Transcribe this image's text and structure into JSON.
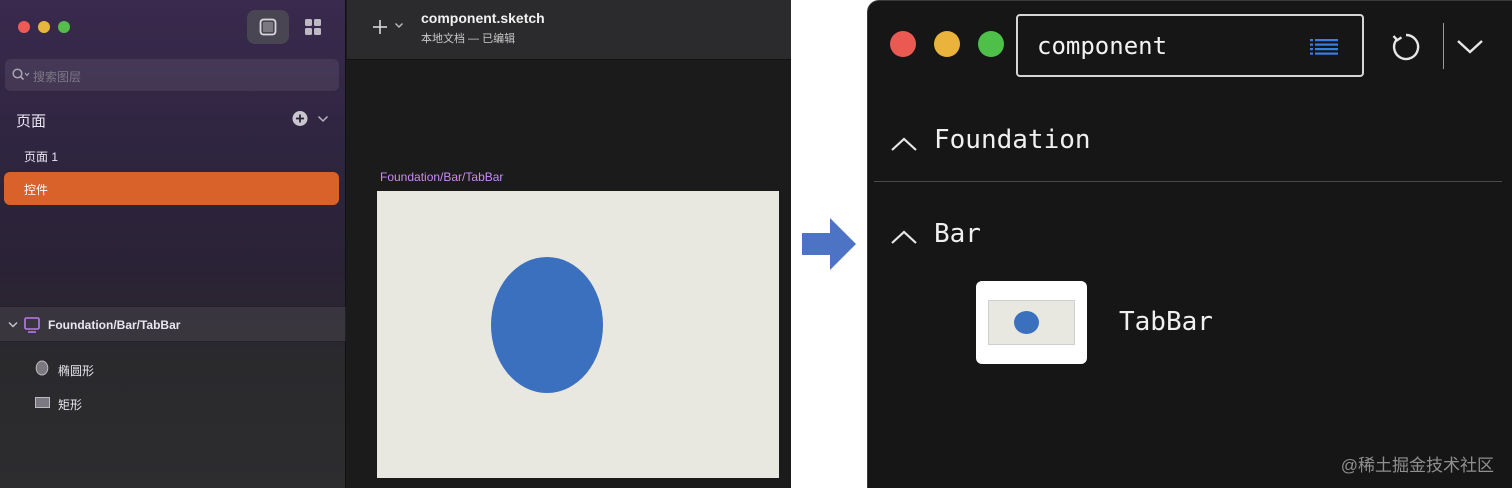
{
  "sketch": {
    "search_placeholder": "搜索图层",
    "pages_header": "页面",
    "pages": [
      {
        "label": "页面 1",
        "selected": false
      },
      {
        "label": "控件",
        "selected": true
      }
    ],
    "layer_group": "Foundation/Bar/TabBar",
    "layers": [
      {
        "label": "椭圆形",
        "icon": "ellipse-layer-icon"
      },
      {
        "label": "矩形",
        "icon": "rectangle-layer-icon"
      }
    ],
    "document_title": "component.sketch",
    "document_subtitle": "本地文档 — 已编辑",
    "artboard_label": "Foundation/Bar/TabBar",
    "colors": {
      "accent": "#d9622b",
      "artboard_label": "#c98cf0",
      "ellipse": "#3b70bf",
      "artboard_bg": "#e8e7e0"
    }
  },
  "arrow": {
    "color": "#4d74c4"
  },
  "plugin": {
    "search_value": "component",
    "sections": [
      {
        "title": "Foundation",
        "expanded": true
      },
      {
        "title": "Bar",
        "expanded": true
      }
    ],
    "component_item": "TabBar",
    "colors": {
      "list_icon": "#3b7ee0"
    }
  },
  "watermark": "@稀土掘金技术社区"
}
